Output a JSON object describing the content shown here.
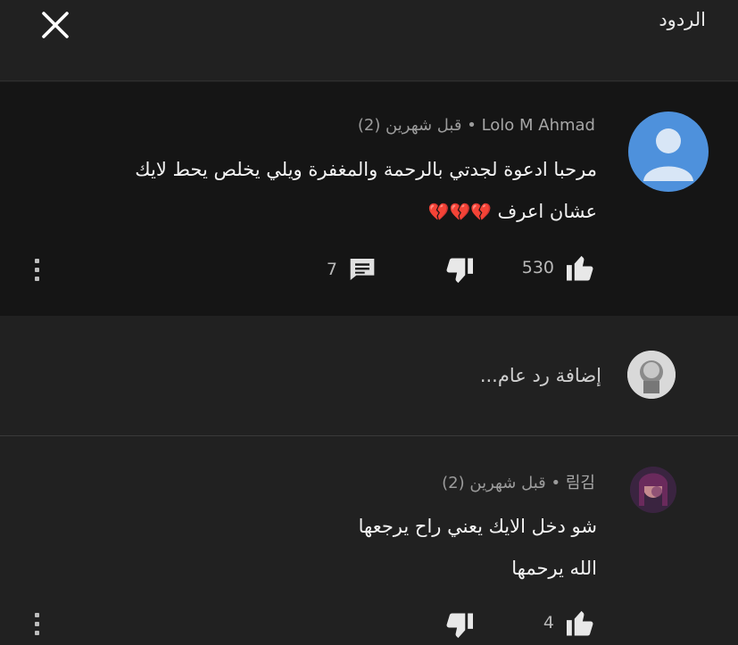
{
  "header": {
    "title": "الردود",
    "close_icon": "close-icon"
  },
  "main_comment": {
    "author": "Lolo M Ahmad",
    "time": "قبل شهرين (2)",
    "separator": "•",
    "text_line1": "مرحبا ادعوة لجدتي بالرحمة والمغفرة ويلي يخلص يحط لايك",
    "text_line2": "عشان اعرف",
    "emoji": "💔💔💔",
    "likes": "530",
    "replies": "7"
  },
  "reply_box": {
    "placeholder": "إضافة رد عام..."
  },
  "reply_comment": {
    "author": "림김",
    "time": "قبل شهرين (2)",
    "separator": "•",
    "text_line1": "شو دخل الايك يعني راح يرجعها",
    "text_line2": "الله يرحمها",
    "likes": "4"
  },
  "colors": {
    "background": "#212121",
    "highlight": "#151515",
    "avatar_blue": "#4e91dc"
  }
}
